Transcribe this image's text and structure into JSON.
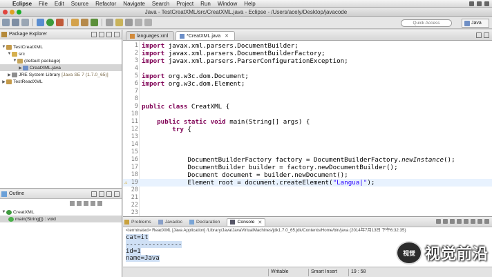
{
  "menubar": {
    "app": "Eclipse",
    "items": [
      "File",
      "Edit",
      "Source",
      "Refactor",
      "Navigate",
      "Search",
      "Project",
      "Run",
      "Window",
      "Help"
    ]
  },
  "window_title": "Java - TestCreatXML/src/CreatXML.java - Eclipse - /Users/acely/Desktop/javacode",
  "toolbar": {
    "quick_access": "Quick Access",
    "perspective": "Java"
  },
  "package_explorer": {
    "title": "Package Explorer",
    "tree": [
      {
        "label": "TestCreatXML",
        "level": 0,
        "icon": "project-icon",
        "expanded": true
      },
      {
        "label": "src",
        "level": 1,
        "icon": "source-folder-icon",
        "expanded": true
      },
      {
        "label": "(default package)",
        "level": 2,
        "icon": "package-icon",
        "expanded": true
      },
      {
        "label": "CreatXML.java",
        "level": 3,
        "icon": "java-file-icon",
        "expanded": false
      },
      {
        "label": "JRE System Library",
        "note": "[Java SE 7 (1.7.0_65)]",
        "level": 1,
        "icon": "library-icon",
        "expanded": false
      },
      {
        "label": "TestReadXML",
        "level": 0,
        "icon": "project-icon",
        "expanded": false
      }
    ]
  },
  "outline": {
    "title": "Outline",
    "tree": [
      {
        "label": "CreatXML",
        "level": 0,
        "icon": "class-icon"
      },
      {
        "label": "main(String[]) : void",
        "level": 1,
        "icon": "method-icon"
      }
    ]
  },
  "editor": {
    "tabs": [
      {
        "label": "languages.xml",
        "active": false
      },
      {
        "label": "*CreatXML.java",
        "active": true
      }
    ],
    "current_line": 19,
    "lines": [
      {
        "n": "1",
        "html": "<span class=\"kw\">import</span> javax.xml.parsers.DocumentBuilder;"
      },
      {
        "n": "2",
        "html": "<span class=\"kw\">import</span> javax.xml.parsers.DocumentBuilderFactory;"
      },
      {
        "n": "3",
        "html": "<span class=\"kw\">import</span> javax.xml.parsers.ParserConfigurationException;"
      },
      {
        "n": "4",
        "html": ""
      },
      {
        "n": "5",
        "html": "<span class=\"kw\">import</span> org.w3c.dom.Document;"
      },
      {
        "n": "6",
        "html": "<span class=\"kw\">import</span> org.w3c.dom.Element;"
      },
      {
        "n": "7",
        "html": ""
      },
      {
        "n": "8",
        "html": ""
      },
      {
        "n": "9",
        "html": "<span class=\"kw\">public class</span> CreatXML {"
      },
      {
        "n": "10",
        "html": ""
      },
      {
        "n": "11",
        "html": "    <span class=\"kw\">public static void</span> main(String[] args) {"
      },
      {
        "n": "12",
        "html": "        <span class=\"kw\">try</span> {"
      },
      {
        "n": "13",
        "html": ""
      },
      {
        "n": "14",
        "html": ""
      },
      {
        "n": "15",
        "html": ""
      },
      {
        "n": "16",
        "html": "            DocumentBuilderFactory factory = DocumentBuilderFactory.<span class=\"it\">newInstance</span>();"
      },
      {
        "n": "17",
        "html": "            DocumentBuilder builder = factory.newDocumentBuilder();"
      },
      {
        "n": "18",
        "html": "            Document document = builder.newDocument();"
      },
      {
        "n": "19",
        "html": "            Element root = document.createElement(<span class=\"str\">\"Langua|\"</span>);"
      },
      {
        "n": "20",
        "html": ""
      },
      {
        "n": "21",
        "html": ""
      },
      {
        "n": "22",
        "html": ""
      },
      {
        "n": "23",
        "html": ""
      }
    ]
  },
  "console": {
    "tabs": [
      "Problems",
      "Javadoc",
      "Declaration",
      "Console"
    ],
    "active_tab": "Console",
    "terminated": "<terminated> ReadXML [Java Application] /Library/Java/JavaVirtualMachines/jdk1.7.0_65.jdk/Contents/Home/bin/java (2014年7月13日 下午6:32:35)",
    "output": [
      "cat=it",
      "---------------",
      "id=1",
      "name=Java"
    ]
  },
  "status": {
    "mode": "Writable",
    "insert": "Smart Insert",
    "position": "19 : 58"
  },
  "watermark": {
    "logo": "视觉",
    "text": "视觉前沿"
  }
}
